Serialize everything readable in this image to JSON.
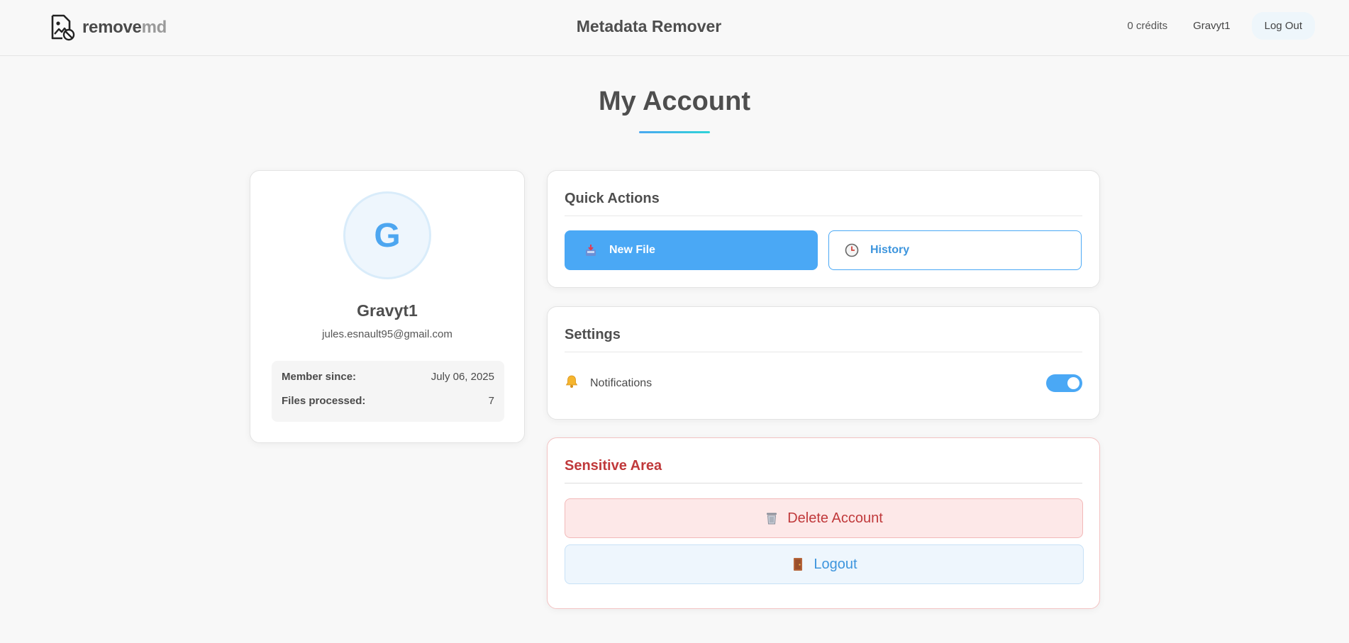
{
  "header": {
    "brand_primary": "remove",
    "brand_secondary": "md",
    "app_title": "Metadata Remover",
    "credits": "0 crédits",
    "username": "Gravyt1",
    "logout_label": "Log Out"
  },
  "page": {
    "title": "My Account"
  },
  "profile": {
    "avatar_initial": "G",
    "name": "Gravyt1",
    "email": "jules.esnault95@gmail.com",
    "stats": [
      {
        "label": "Member since:",
        "value": "July 06, 2025"
      },
      {
        "label": "Files processed:",
        "value": "7"
      }
    ]
  },
  "quick_actions": {
    "title": "Quick Actions",
    "new_file_label": "New File",
    "history_label": "History",
    "new_file_icon": "inbox-tray-icon",
    "history_icon": "clock-icon"
  },
  "settings": {
    "title": "Settings",
    "notifications_label": "Notifications",
    "notifications_enabled": true,
    "notifications_icon": "bell-icon"
  },
  "sensitive": {
    "title": "Sensitive Area",
    "delete_label": "Delete Account",
    "logout_label": "Logout",
    "delete_icon": "trash-can-icon",
    "logout_icon": "door-icon"
  },
  "colors": {
    "accent": "#4aa8f5",
    "danger": "#c0393b",
    "background": "#f8f8f8"
  }
}
